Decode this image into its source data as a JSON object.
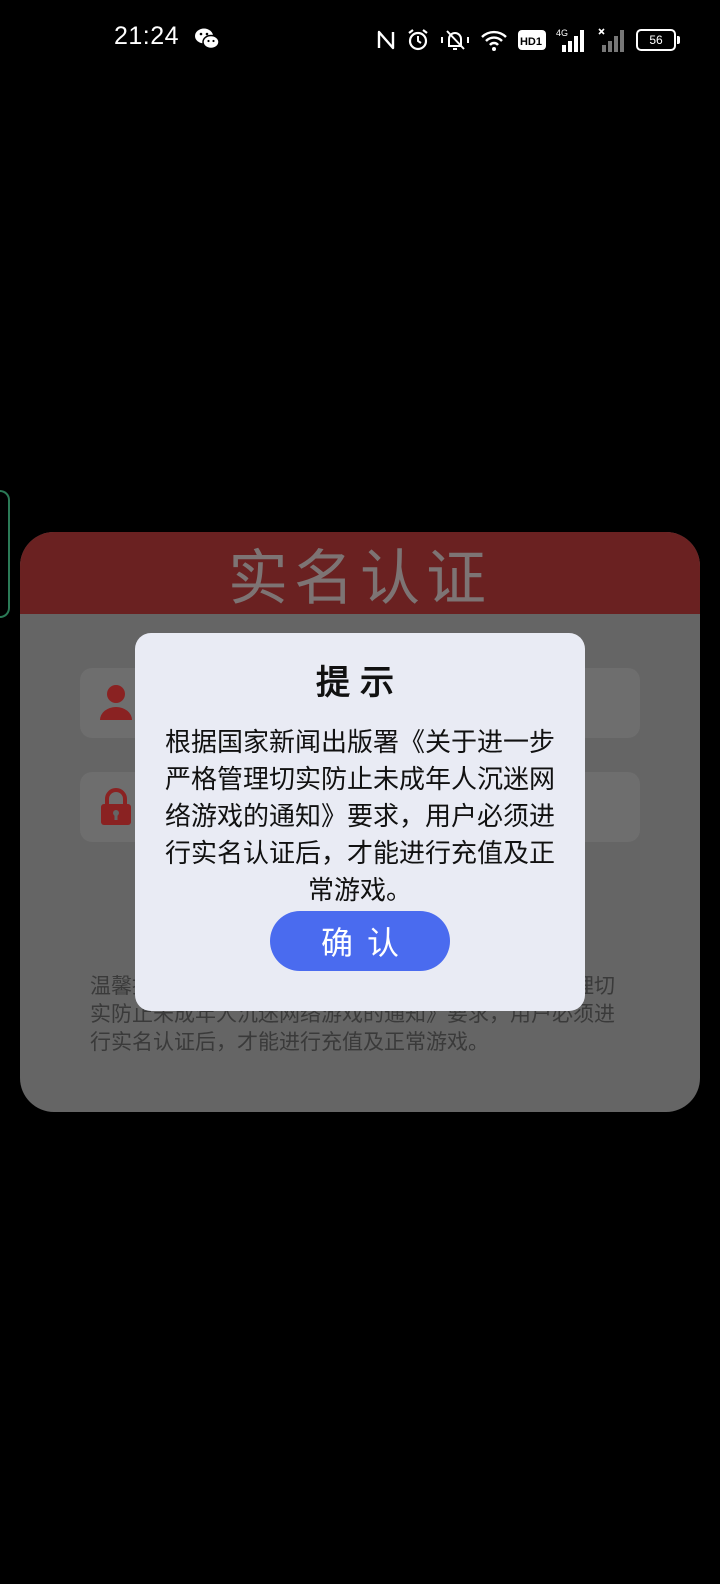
{
  "status_bar": {
    "time": "21:24",
    "battery": "56",
    "hd_label": "HD1",
    "network_label": "4G",
    "icons": [
      "wechat-icon",
      "nfc-icon",
      "alarm-icon",
      "mute-icon",
      "wifi-icon",
      "hd-icon",
      "signal-4g-icon",
      "signal-icon",
      "battery-icon"
    ]
  },
  "panel": {
    "title": "实名认证",
    "notice": "温馨提示：根据国家新闻出版署《关于进一步严格管理切实防止未成年人沉迷网络游戏的通知》要求，用户必须进行实名认证后，才能进行充值及正常游戏。",
    "colors": {
      "header": "#6a2121",
      "body": "#656565",
      "icon": "#8a2222"
    }
  },
  "dialog": {
    "title": "提示",
    "message": "根据国家新闻出版署《关于进一步严格管理切实防止未成年人沉迷网络游戏的通知》要求，用户必须进行实名认证后，才能进行充值及正常游戏。",
    "confirm_label": "确认",
    "colors": {
      "background": "#e9ebf4",
      "button": "#4a6bef"
    }
  }
}
